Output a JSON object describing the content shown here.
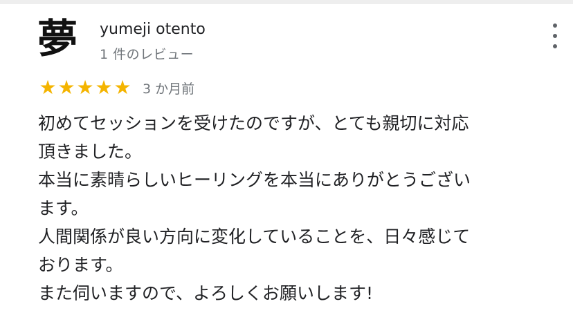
{
  "reviewer": {
    "avatar_glyph": "夢",
    "name": "yumeji otento",
    "review_count": "1 件のレビュー"
  },
  "rating": {
    "stars": 5,
    "max_stars": 5,
    "star_color": "#f4b400",
    "date": "3 か月前"
  },
  "menu": {
    "icon": "more-vert-icon"
  },
  "review": {
    "lines": [
      "初めてセッションを受けたのですが、とても親切に対応",
      "頂きました。",
      "本当に素晴らしいヒーリングを本当にありがとうござい",
      "ます。",
      "人間関係が良い方向に変化していることを、日々感じて",
      "おります。",
      "また伺いますので、よろしくお願いします!"
    ]
  }
}
